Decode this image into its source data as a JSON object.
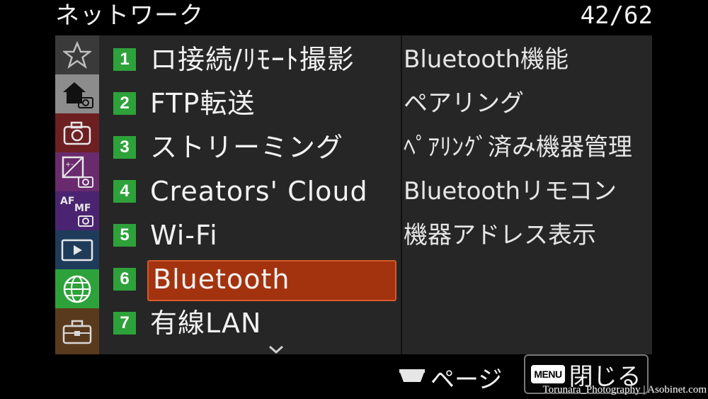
{
  "header": {
    "title": "ネットワーク",
    "page_counter": "42/62"
  },
  "categories": [
    {
      "icon": "star-icon",
      "color": "#3a3a3a"
    },
    {
      "icon": "home-camera-icon",
      "color": "#8c8c8c"
    },
    {
      "icon": "camera-icon",
      "color": "#6e1f22"
    },
    {
      "icon": "exposure-camera-icon",
      "color": "#6a2a6e"
    },
    {
      "icon": "af-mf-camera-icon",
      "color": "#4a2470"
    },
    {
      "icon": "playback-icon",
      "color": "#1e3b5a"
    },
    {
      "icon": "network-globe-icon",
      "color": "#2ea23a"
    },
    {
      "icon": "toolbox-icon",
      "color": "#5a3a1c"
    }
  ],
  "menu": {
    "items": [
      {
        "num": "1",
        "label": "ロ接続/ﾘﾓｰﾄ撮影"
      },
      {
        "num": "2",
        "label": "FTP転送"
      },
      {
        "num": "3",
        "label": "ストリーミング"
      },
      {
        "num": "4",
        "label": "Creators' Cloud"
      },
      {
        "num": "5",
        "label": "Wi-Fi"
      },
      {
        "num": "6",
        "label": "Bluetooth"
      },
      {
        "num": "7",
        "label": "有線LAN"
      }
    ],
    "selected_index": 5
  },
  "submenu": {
    "items": [
      {
        "label": "Bluetooth機能"
      },
      {
        "label": "ペアリング"
      },
      {
        "label": "ﾍﾟｱﾘﾝｸﾞ済み機器管理"
      },
      {
        "label": "Bluetoothリモコン"
      },
      {
        "label": "機器アドレス表示"
      }
    ]
  },
  "footer": {
    "page_label": "ページ",
    "menu_key": "MENU",
    "close_label": "閉じる"
  },
  "watermark": "Torunara_Photography | Asobinet.com"
}
